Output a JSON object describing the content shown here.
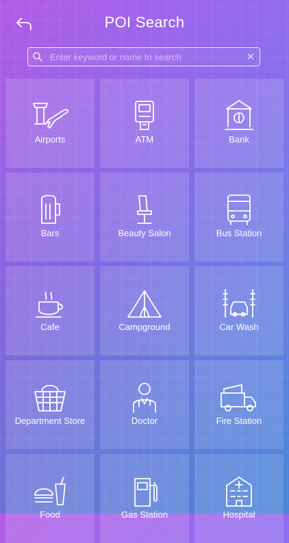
{
  "header": {
    "title": "POI Search",
    "back_icon": "back-arrow-icon"
  },
  "search": {
    "placeholder": "Enter keyword or name to search",
    "value": "",
    "clear_label": "✕"
  },
  "categories": [
    {
      "label": "Airports",
      "icon": "airport-icon"
    },
    {
      "label": "ATM",
      "icon": "atm-icon"
    },
    {
      "label": "Bank",
      "icon": "bank-icon"
    },
    {
      "label": "Bars",
      "icon": "beer-mug-icon"
    },
    {
      "label": "Beauty Salon",
      "icon": "salon-chair-icon"
    },
    {
      "label": "Bus Station",
      "icon": "bus-icon"
    },
    {
      "label": "Cafe",
      "icon": "coffee-cup-icon"
    },
    {
      "label": "Campground",
      "icon": "tent-icon"
    },
    {
      "label": "Car Wash",
      "icon": "car-wash-icon"
    },
    {
      "label": "Department Store",
      "icon": "basket-icon"
    },
    {
      "label": "Doctor",
      "icon": "doctor-icon"
    },
    {
      "label": "Fire Station",
      "icon": "fire-truck-icon"
    },
    {
      "label": "Food",
      "icon": "fast-food-icon"
    },
    {
      "label": "Gas Station",
      "icon": "gas-pump-icon"
    },
    {
      "label": "Hospital",
      "icon": "hospital-icon"
    }
  ]
}
